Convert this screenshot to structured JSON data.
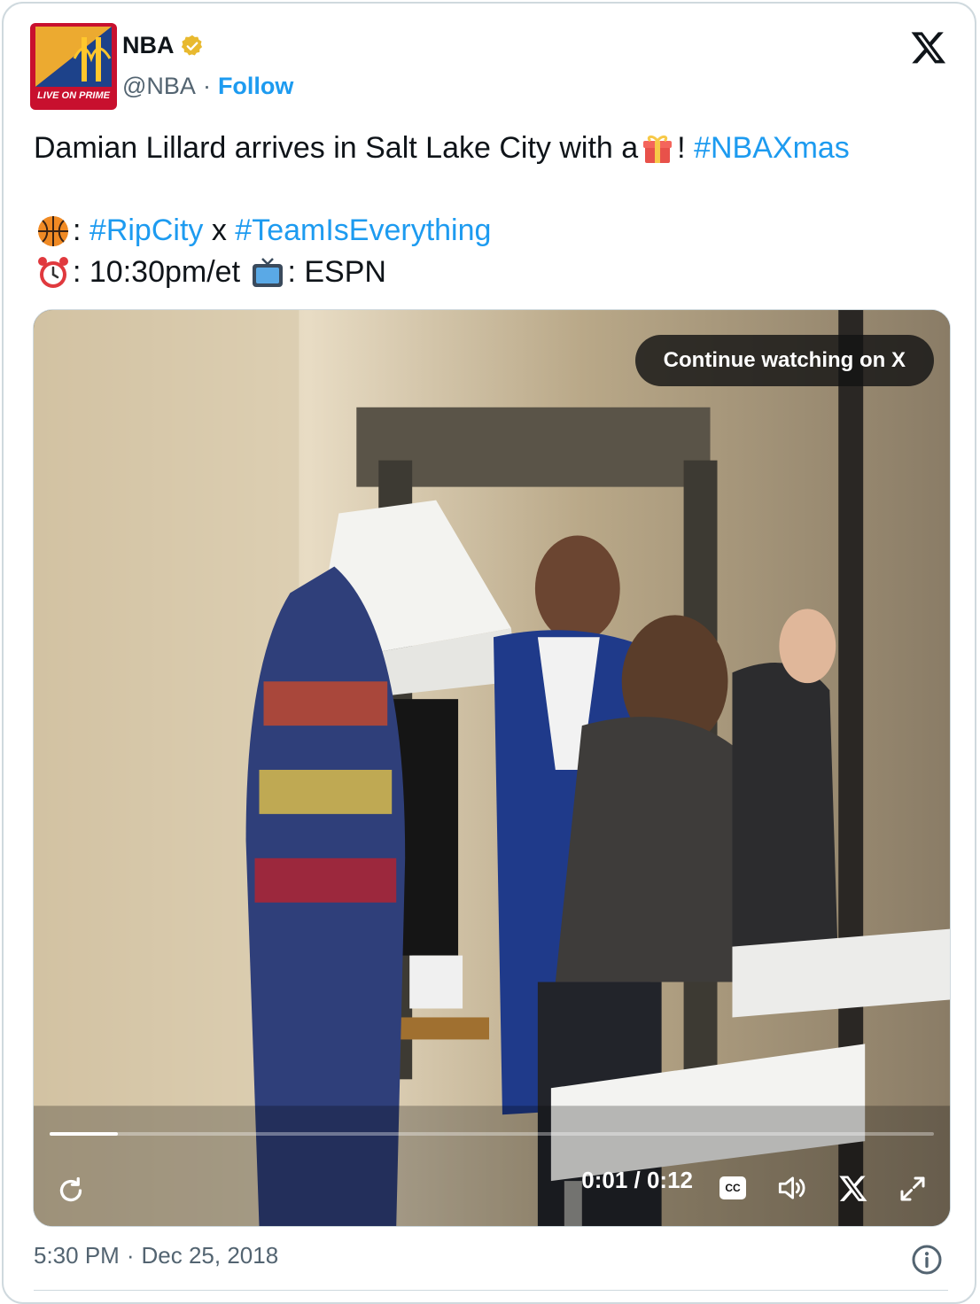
{
  "author": {
    "display_name": "NBA",
    "handle": "@NBA",
    "separator": "·",
    "follow_label": "Follow",
    "avatar_banner": "LIVE ON PRIME",
    "verified": true
  },
  "tweet": {
    "line1_text": "Damian Lillard arrives in Salt Lake City with a ",
    "line1_after_emoji": "! ",
    "line1_hashtag": "#NBAXmas",
    "line2_sep": ": ",
    "line2_tag1": "#RipCity",
    "line2_x": " x ",
    "line2_tag2": "#TeamIsEverything",
    "line3_sep1": ": 10:30pm/et ",
    "line3_sep2": ": ESPN"
  },
  "video": {
    "continue_label": "Continue watching on X",
    "current_time": "0:01",
    "time_separator": " / ",
    "duration": "0:12",
    "progress": 0.077,
    "cc_label": "CC"
  },
  "footer": {
    "time": "5:30 PM",
    "separator": "·",
    "date": "Dec 25, 2018"
  },
  "colors": {
    "link": "#1d9bf0",
    "text": "#0f1419",
    "muted": "#536471",
    "border": "#cfd9de",
    "verified": "#e8b92f"
  },
  "icons": [
    "x-logo-icon",
    "verified-badge-icon",
    "gift-emoji",
    "basketball-emoji",
    "alarm-clock-emoji",
    "tv-emoji",
    "replay-icon",
    "cc-icon",
    "volume-icon",
    "x-logo-icon",
    "fullscreen-icon",
    "info-icon"
  ]
}
